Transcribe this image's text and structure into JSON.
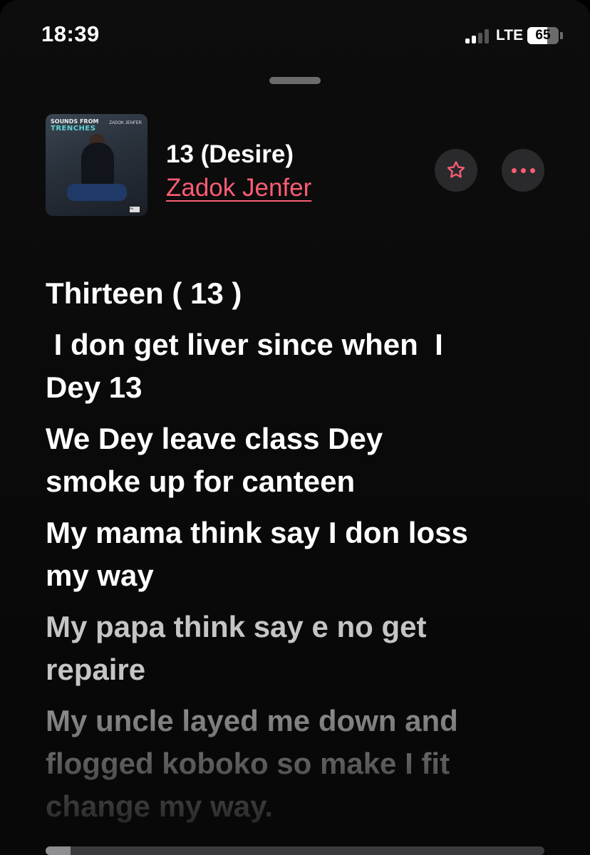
{
  "status_bar": {
    "time": "18:39",
    "network": "LTE",
    "battery_percent": "65",
    "signal_bars_active": 2,
    "signal_bars_total": 4
  },
  "now_playing": {
    "track_title": "13 (Desire)",
    "artist": "Zadok Jenfer",
    "artwork": {
      "album_title_line1": "SOUNDS FROM",
      "album_title_line2": "TRENCHES",
      "artist_text": "ZADOK JENFER",
      "parental_advisory": "PA"
    },
    "favorite_icon": "star-icon",
    "more_icon": "ellipsis-icon"
  },
  "lyrics": [
    "Thirteen ( 13 )",
    " I don get liver since when  I\nDey 13",
    "We Dey leave class Dey\nsmoke up for canteen",
    "My mama think say I don loss\nmy way",
    "My papa think say e no get\nrepaire",
    "My uncle layed me down and\nflogged koboko so make I fit\nchange my way."
  ],
  "playback": {
    "progress_fraction": 0.05
  },
  "colors": {
    "accent": "#fb5c74",
    "background": "#0a0a0a",
    "button_bg": "#2a2a2c"
  }
}
